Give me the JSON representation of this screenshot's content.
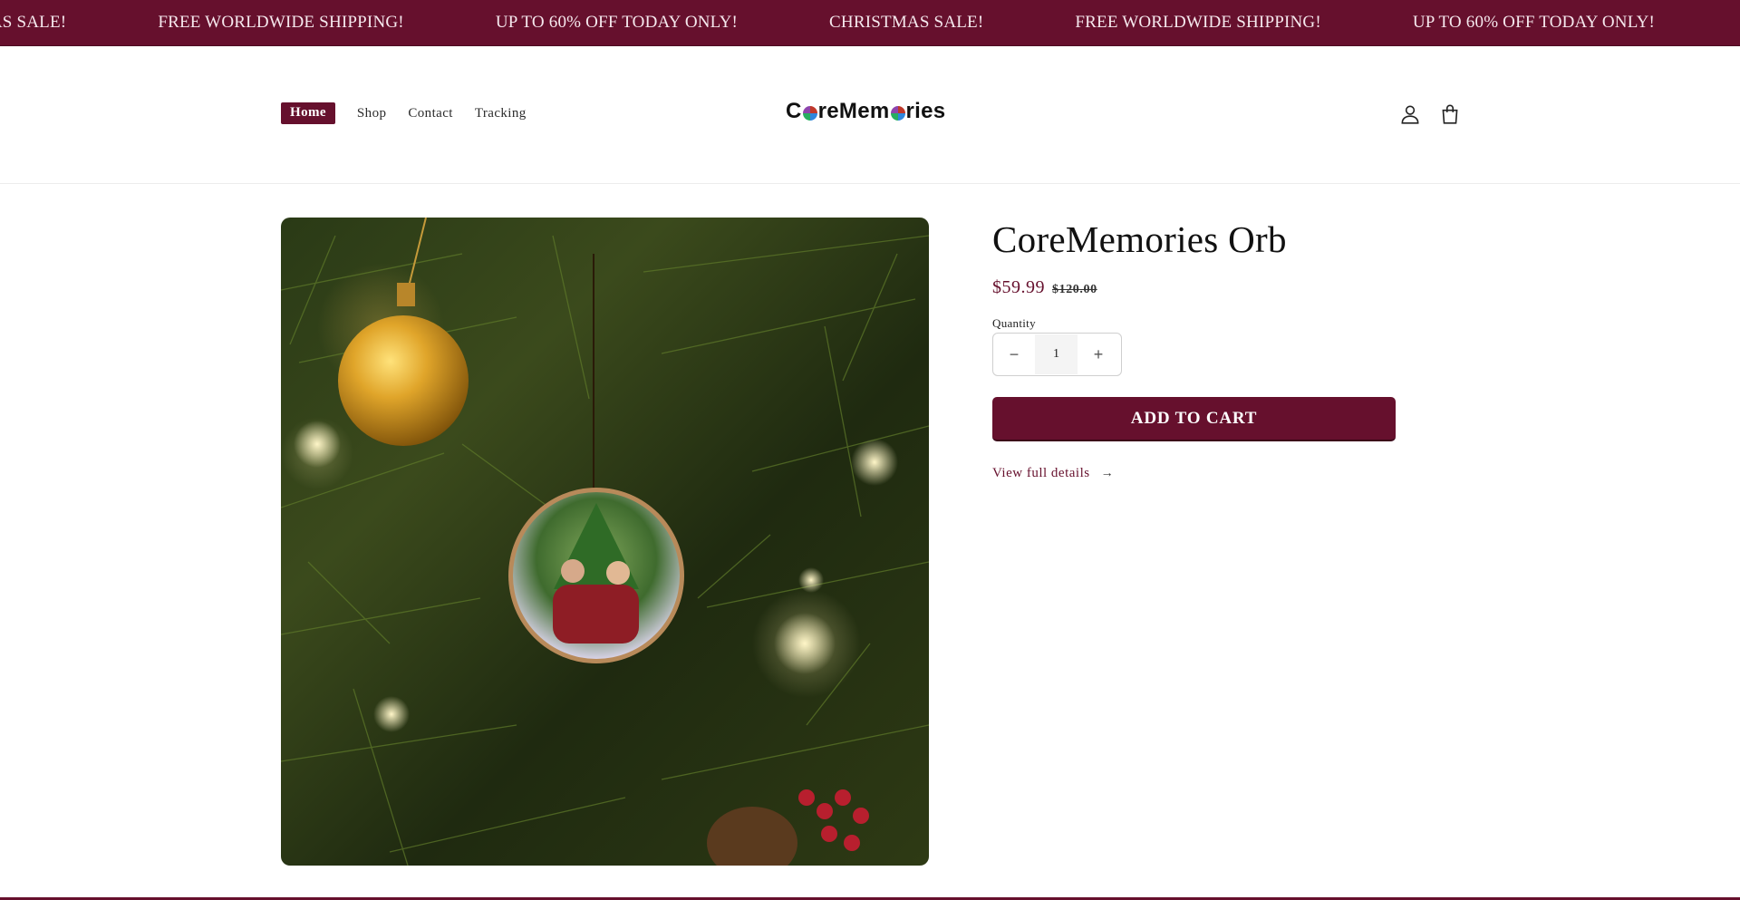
{
  "announcement": {
    "messages": [
      "CHRISTMAS SALE!",
      "FREE WORLDWIDE SHIPPING!",
      "UP TO 60% OFF TODAY ONLY!",
      "CHRISTMAS SALE!",
      "FREE WORLDWIDE SHIPPING!",
      "UP TO 60% OFF TODAY ONLY!"
    ]
  },
  "nav": {
    "items": [
      {
        "label": "Home",
        "active": true
      },
      {
        "label": "Shop",
        "active": false
      },
      {
        "label": "Contact",
        "active": false
      },
      {
        "label": "Tracking",
        "active": false
      }
    ]
  },
  "logo": {
    "part1": "C",
    "part2": "reMem",
    "part3": "ries"
  },
  "header_icons": [
    "account-icon",
    "cart-icon"
  ],
  "product": {
    "title": "CoreMemories Orb",
    "price": "$59.99",
    "compare_price": "$120.00",
    "quantity_label": "Quantity",
    "quantity_value": "1",
    "minus_symbol": "−",
    "plus_symbol": "+",
    "add_to_cart": "ADD TO CART",
    "view_details": "View full details",
    "view_details_arrow": "→"
  },
  "colors": {
    "brand": "#66102d",
    "announcement_text": "#f6e9ee"
  }
}
